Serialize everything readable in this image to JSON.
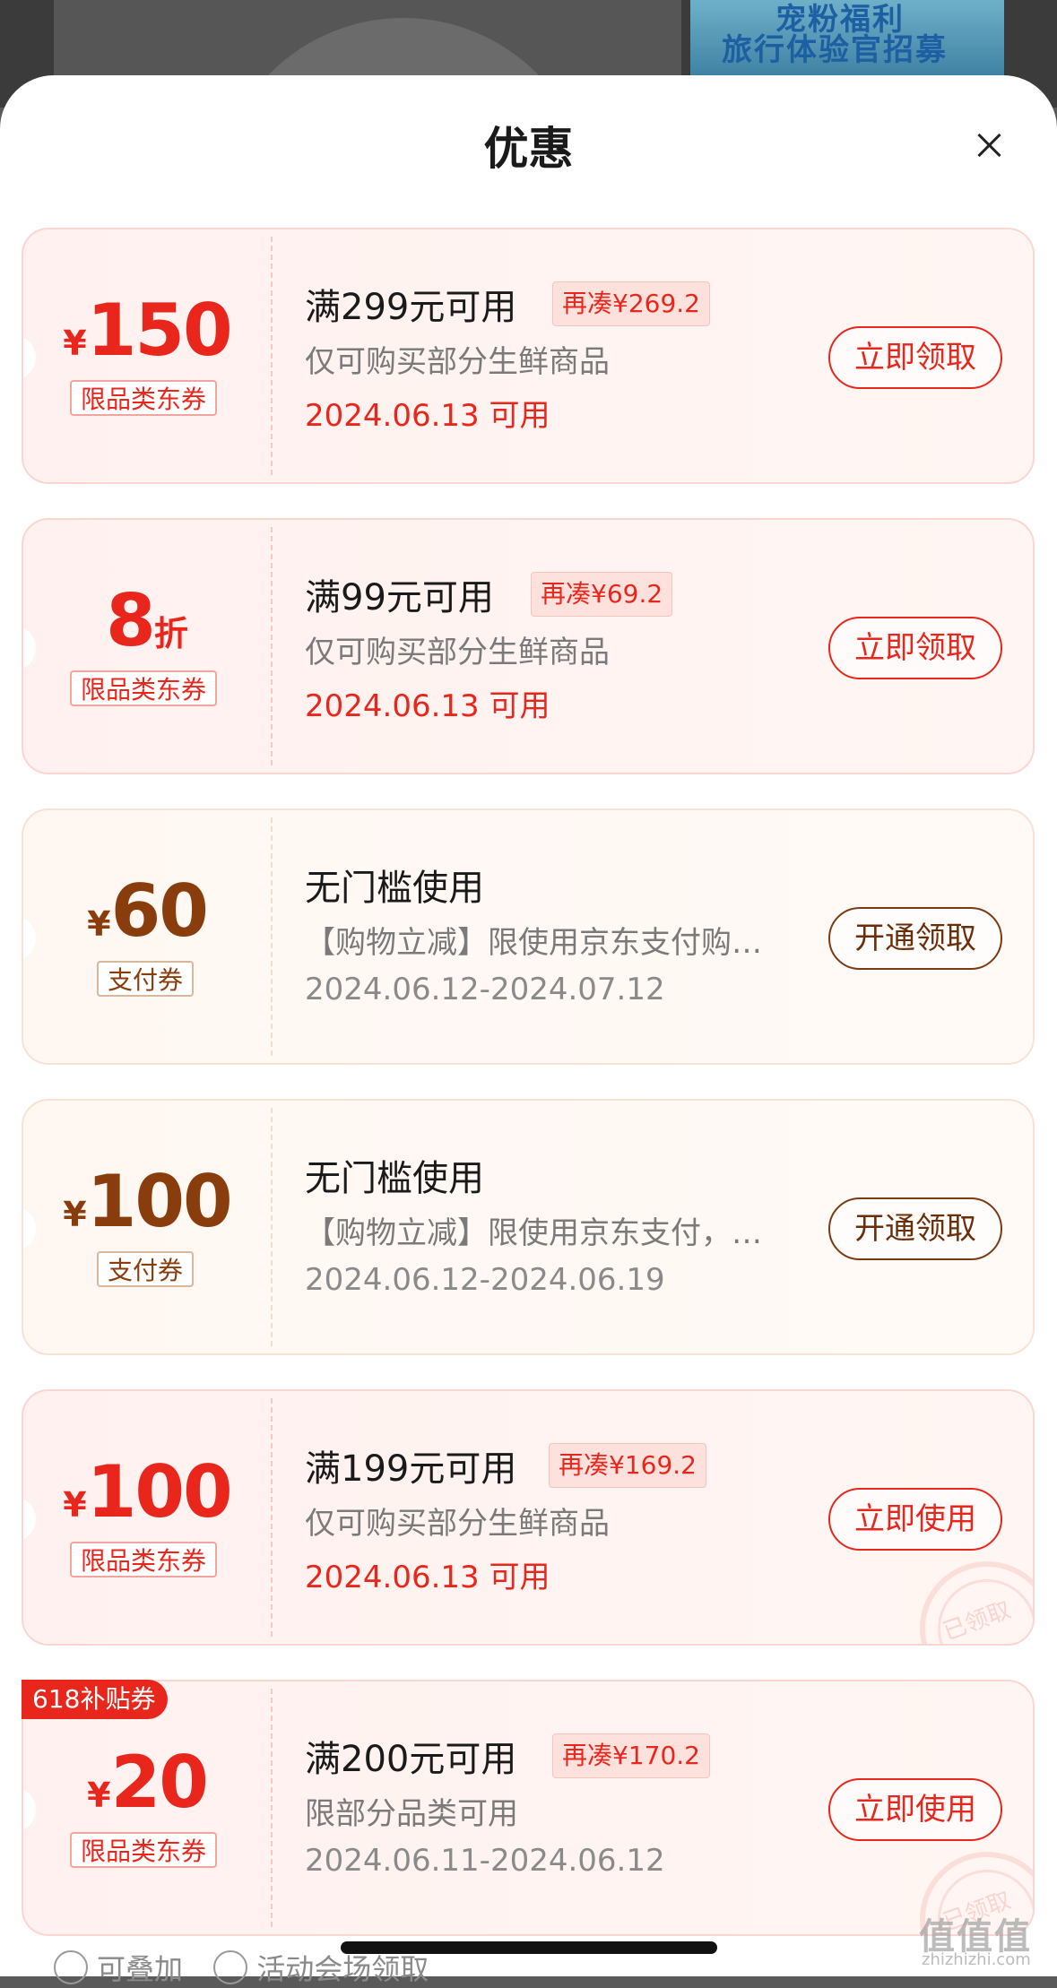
{
  "header": {
    "title": "优惠"
  },
  "coupons": [
    {
      "yen": "¥",
      "amount": "150",
      "unit": "",
      "tag": "限品类东券",
      "condition": "满299元可用",
      "need": "再凑¥269.2",
      "desc": "仅可购买部分生鲜商品",
      "date": "2024.06.13 可用",
      "action": "立即领取",
      "theme": "red"
    },
    {
      "yen": "",
      "amount": "8",
      "unit": "折",
      "tag": "限品类东券",
      "condition": "满99元可用",
      "need": "再凑¥69.2",
      "desc": "仅可购买部分生鲜商品",
      "date": "2024.06.13 可用",
      "action": "立即领取",
      "theme": "red"
    },
    {
      "yen": "¥",
      "amount": "60",
      "unit": "",
      "tag": "支付券",
      "condition": "无门槛使用",
      "need": "",
      "desc": "【购物立减】限使用京东支付购…",
      "date": "2024.06.12-2024.07.12",
      "action": "开通领取",
      "theme": "brown"
    },
    {
      "yen": "¥",
      "amount": "100",
      "unit": "",
      "tag": "支付券",
      "condition": "无门槛使用",
      "need": "",
      "desc": "【购物立减】限使用京东支付，…",
      "date": "2024.06.12-2024.06.19",
      "action": "开通领取",
      "theme": "brown"
    },
    {
      "yen": "¥",
      "amount": "100",
      "unit": "",
      "tag": "限品类东券",
      "condition": "满199元可用",
      "need": "再凑¥169.2",
      "desc": "仅可购买部分生鲜商品",
      "date": "2024.06.13 可用",
      "action": "立即使用",
      "theme": "red",
      "stamp": "已领取"
    },
    {
      "yen": "¥",
      "amount": "20",
      "unit": "",
      "tag": "限品类东券",
      "condition": "满200元可用",
      "need": "再凑¥170.2",
      "desc": "限部分品类可用",
      "date": "2024.06.11-2024.06.12",
      "action": "立即使用",
      "theme": "red",
      "ribbon": "618补贴券",
      "stamp": "已领取"
    }
  ],
  "footer": {
    "stackable": "可叠加",
    "venue": "活动会场领取"
  },
  "background": {
    "banner_line1": "宠粉福利",
    "banner_line2": "旅行体验官招募"
  },
  "watermark": {
    "main": "值值值",
    "sub": "zhizhizhi.com"
  },
  "colors": {
    "accent_red": "#e8261c",
    "accent_brown": "#8a3d0c"
  }
}
